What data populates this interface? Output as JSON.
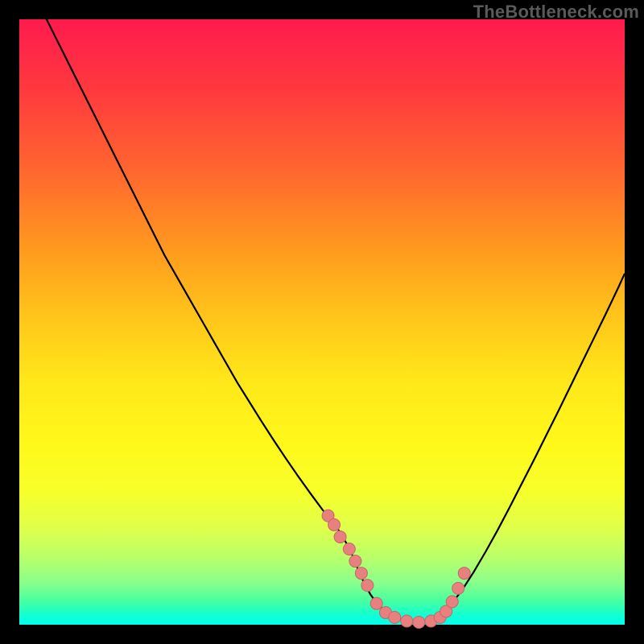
{
  "watermark": {
    "text": "TheBottleneck.com"
  },
  "colors": {
    "background": "#000000",
    "curve": "#000000",
    "point_fill": "#e98080",
    "point_stroke": "#c06868"
  },
  "chart_data": {
    "type": "line",
    "title": "",
    "xlabel": "",
    "ylabel": "",
    "xlim": [
      0,
      100
    ],
    "ylim": [
      0,
      100
    ],
    "grid": false,
    "legend": false,
    "x": [
      0,
      2,
      4,
      6,
      8,
      10,
      12,
      14,
      16,
      18,
      20,
      22,
      24,
      26,
      28,
      30,
      32,
      34,
      36,
      38,
      40,
      42,
      44,
      46,
      48,
      50,
      51,
      52,
      53,
      54,
      55,
      56,
      57,
      58,
      59,
      60,
      62,
      64,
      66,
      68,
      69,
      70,
      71,
      73,
      75,
      77,
      79,
      81,
      83,
      85,
      87,
      89,
      91,
      93,
      95,
      97,
      99,
      100
    ],
    "y": [
      108,
      105,
      101,
      97,
      93,
      89,
      85,
      81,
      77,
      73,
      69,
      65,
      61,
      57.5,
      54,
      50.5,
      47,
      43.5,
      40,
      36.8,
      33.6,
      30.5,
      27.5,
      24.6,
      21.8,
      19.1,
      17.8,
      16.5,
      15.3,
      13.5,
      11.5,
      9.0,
      6.8,
      5.0,
      3.6,
      2.6,
      1.3,
      0.6,
      0.4,
      0.8,
      1.3,
      2.0,
      3.0,
      5.5,
      8.6,
      12.0,
      15.6,
      19.4,
      23.3,
      27.2,
      31.2,
      35.2,
      39.3,
      43.4,
      47.5,
      51.6,
      55.8,
      58.0
    ],
    "highlighted_points": {
      "x": [
        51.0,
        52.0,
        53.0,
        54.5,
        55.5,
        56.5,
        57.5,
        59.0,
        60.5,
        62.0,
        64.0,
        66.0,
        68.0,
        69.5,
        70.5,
        71.5,
        72.5,
        73.5
      ],
      "y": [
        18.0,
        16.5,
        14.5,
        12.5,
        10.5,
        8.5,
        6.5,
        3.5,
        2.0,
        1.2,
        0.6,
        0.4,
        0.6,
        1.2,
        2.2,
        3.8,
        6.0,
        8.5
      ]
    }
  }
}
